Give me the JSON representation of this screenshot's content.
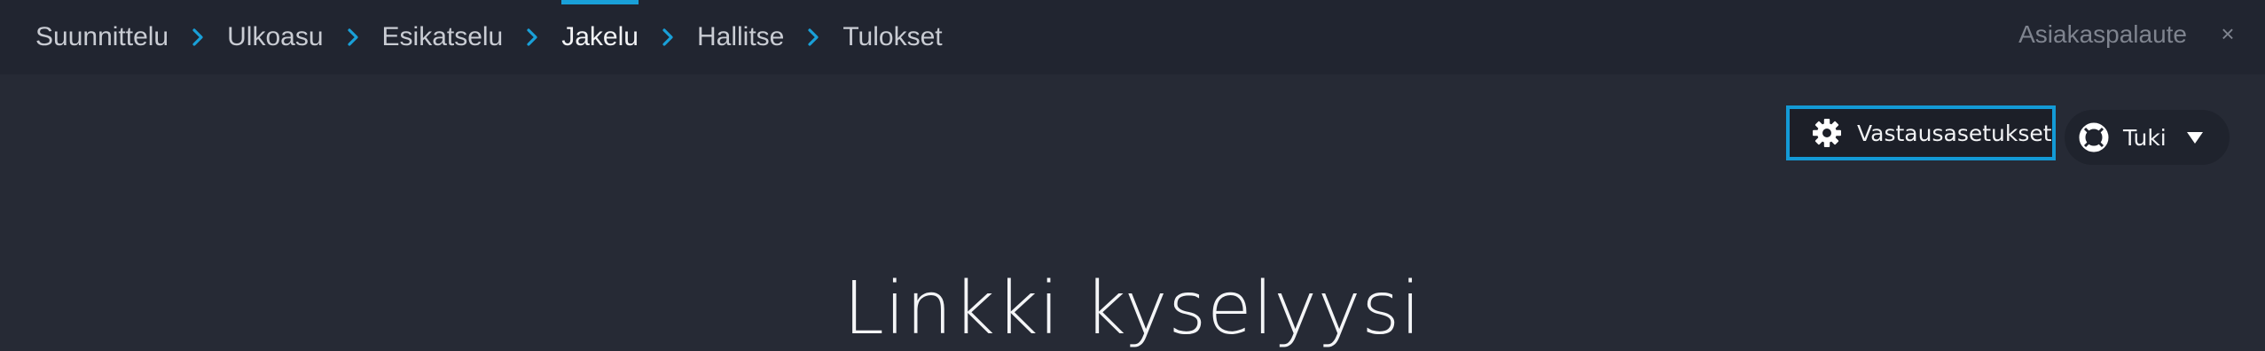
{
  "breadcrumb": {
    "steps": [
      {
        "label": "Suunnittelu"
      },
      {
        "label": "Ulkoasu"
      },
      {
        "label": "Esikatselu"
      },
      {
        "label": "Jakelu"
      },
      {
        "label": "Hallitse"
      },
      {
        "label": "Tulokset"
      }
    ],
    "active_index": 3
  },
  "header": {
    "feedback_label": "Asiakaspalaute",
    "close_symbol": "×"
  },
  "toolbar": {
    "settings_label": "Vastausasetukset",
    "settings_icon": "gear-icon",
    "support_label": "Tuki",
    "support_icon": "lifebuoy-icon",
    "support_caret_icon": "caret-down-icon"
  },
  "main": {
    "title": "Linkki kyselyysi"
  },
  "colors": {
    "accent": "#139ad6",
    "background": "#262a35",
    "topbar": "#212530"
  }
}
